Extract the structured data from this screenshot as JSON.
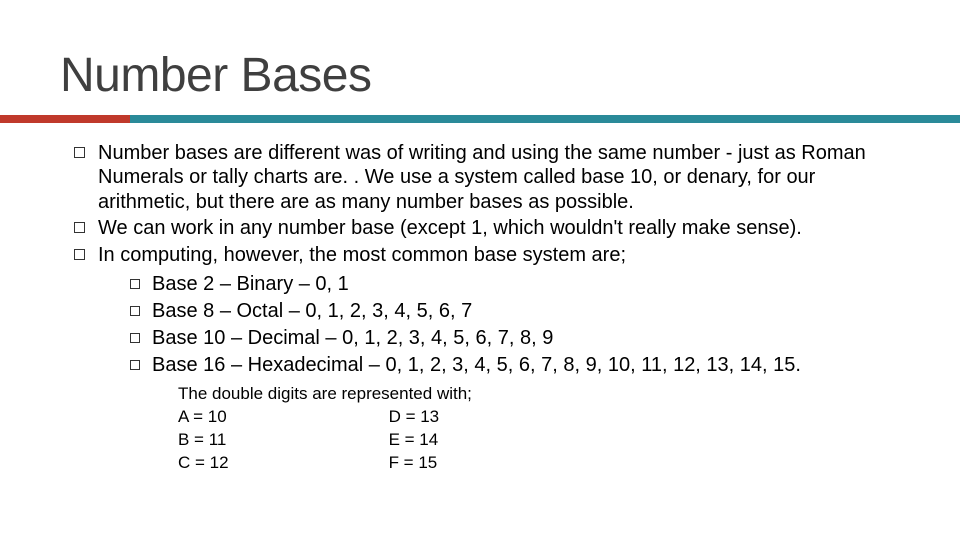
{
  "title": "Number Bases",
  "bullets": {
    "b1": "Number bases are different was of writing and using the same number - just as Roman Numerals or tally charts are. . We use a system called base 10, or denary, for our arithmetic, but there are as many number bases as possible.",
    "b2": "We can work in any number base (except 1, which wouldn't really make sense).",
    "b3": "In computing, however, the most common base system are;"
  },
  "sub": {
    "s1": "Base 2 – Binary – 0, 1",
    "s2": "Base 8 – Octal – 0, 1, 2, 3, 4, 5, 6, 7",
    "s3": "Base 10 – Decimal – 0, 1, 2, 3, 4, 5, 6, 7, 8, 9",
    "s4": "Base 16 – Hexadecimal – 0, 1, 2, 3, 4, 5, 6, 7, 8, 9, 10, 11, 12, 13, 14, 15."
  },
  "note": {
    "heading": "The double digits are represented with;",
    "col1": {
      "a": "A = 10",
      "b": "B = 11",
      "c": "C = 12"
    },
    "col2": {
      "d": "D = 13",
      "e": "E = 14",
      "f": "F = 15"
    }
  }
}
